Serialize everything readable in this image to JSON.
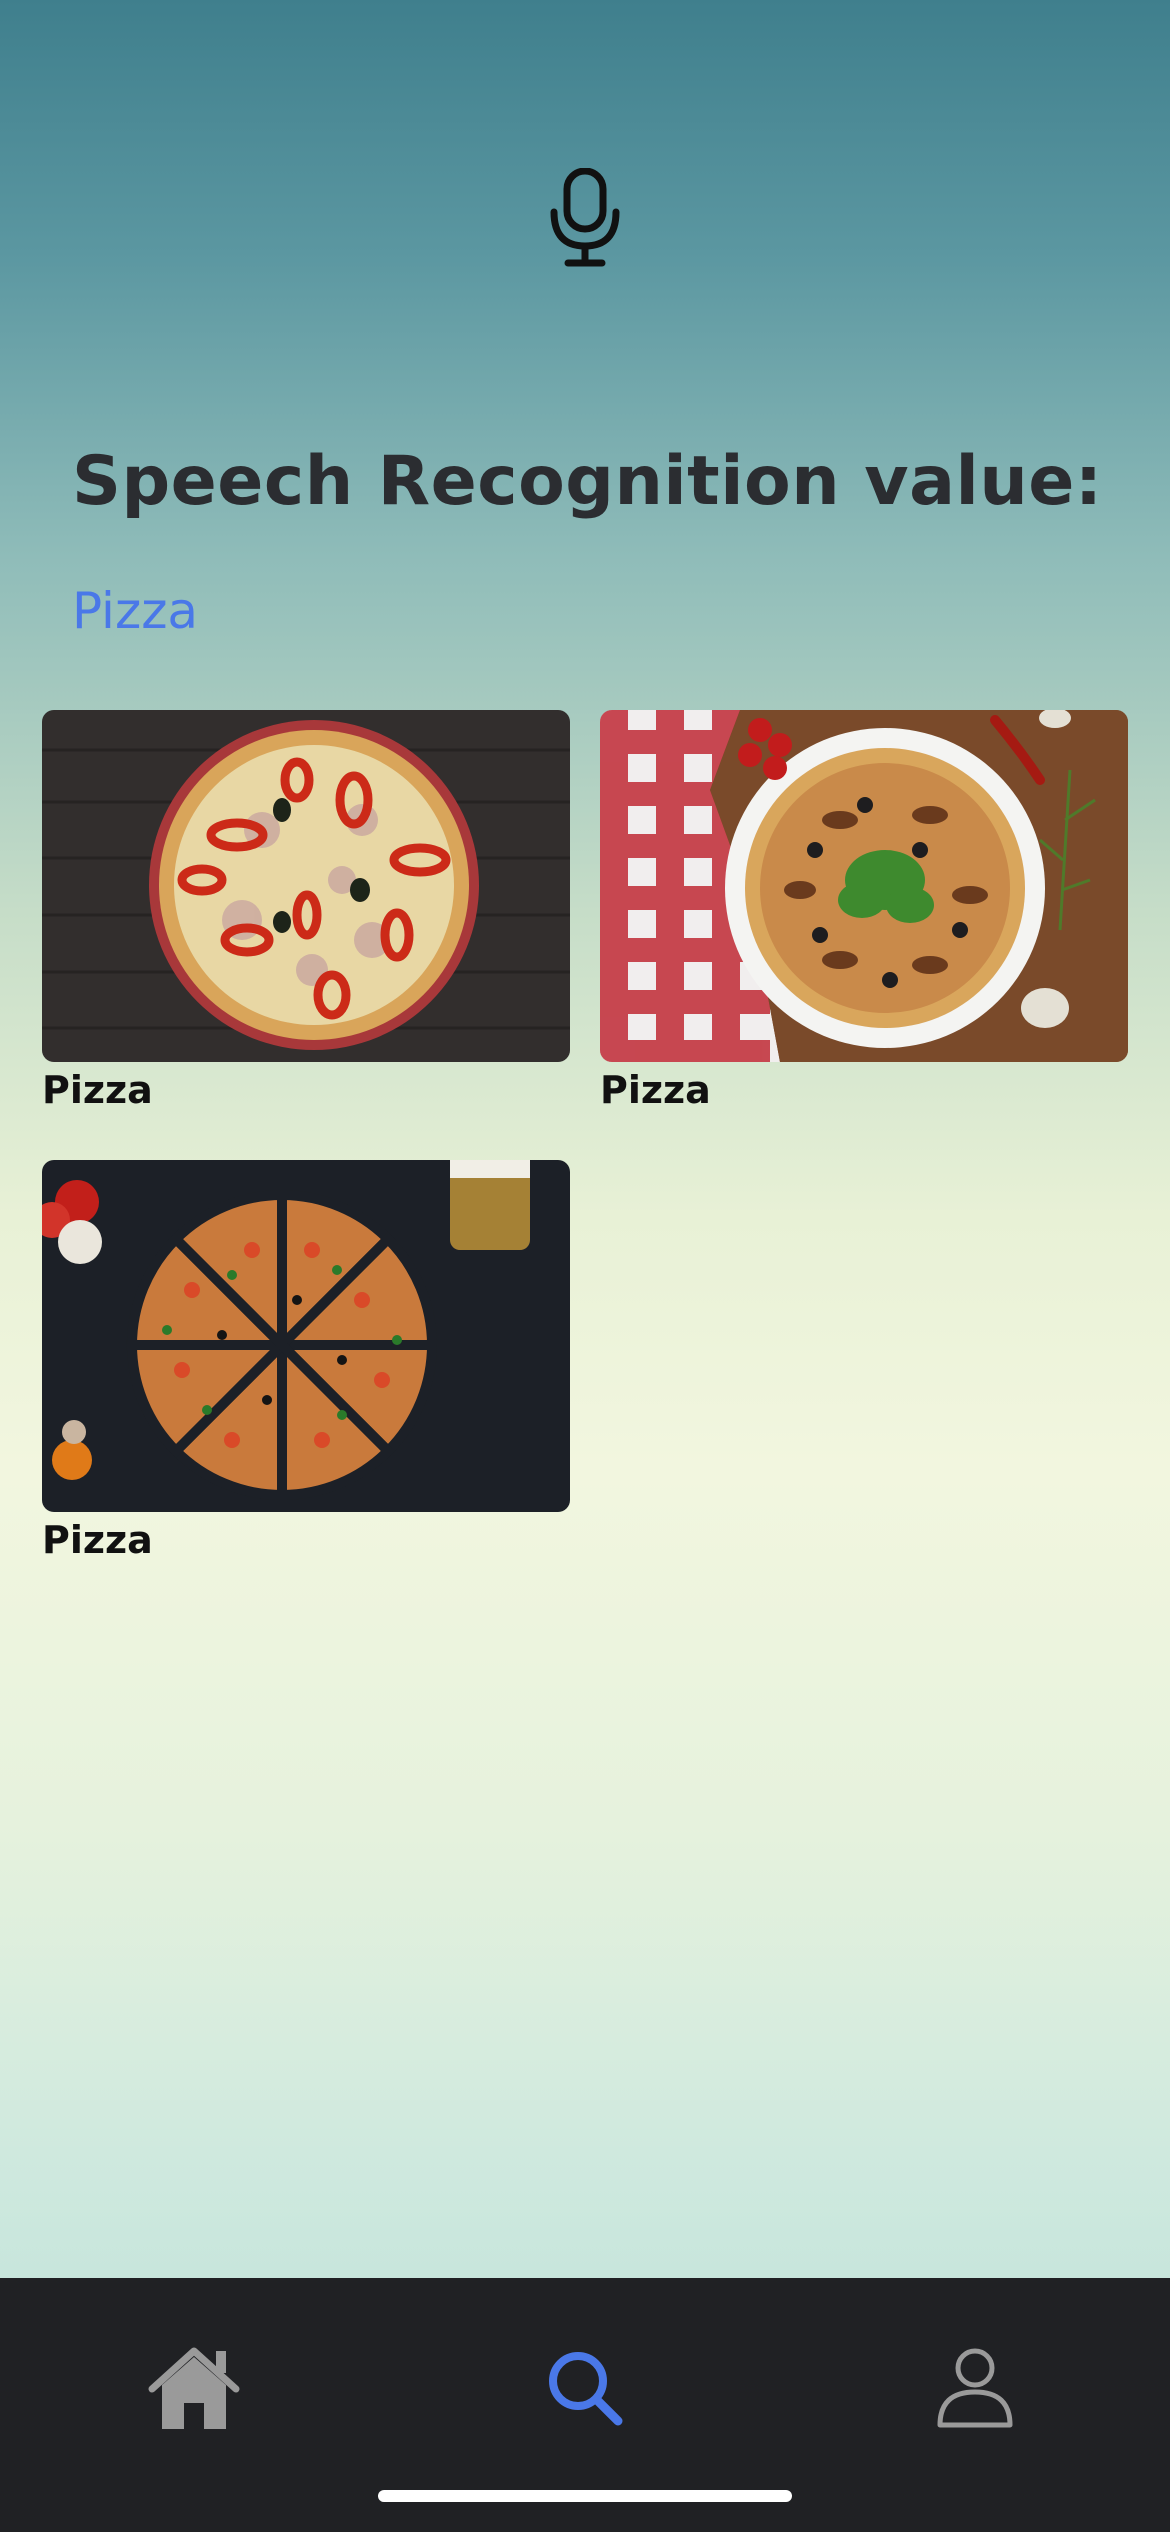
{
  "header": {
    "mic_icon": "microphone-icon",
    "title": "Speech Recognition value:",
    "recognized_value": "Pizza"
  },
  "colors": {
    "accent": "#4a78e8",
    "title": "#2b2d31",
    "tabbar": "#202124",
    "tab_inactive": "#9a9a9a"
  },
  "results": [
    {
      "label": "Pizza",
      "image": "pizza-on-dark-wood"
    },
    {
      "label": "Pizza",
      "image": "pizza-with-checkered-cloth"
    },
    {
      "label": "Pizza",
      "image": "sliced-pizza-on-black"
    }
  ],
  "tabbar": {
    "items": [
      {
        "icon": "home-icon",
        "active": false
      },
      {
        "icon": "search-icon",
        "active": true
      },
      {
        "icon": "user-icon",
        "active": false
      }
    ]
  }
}
